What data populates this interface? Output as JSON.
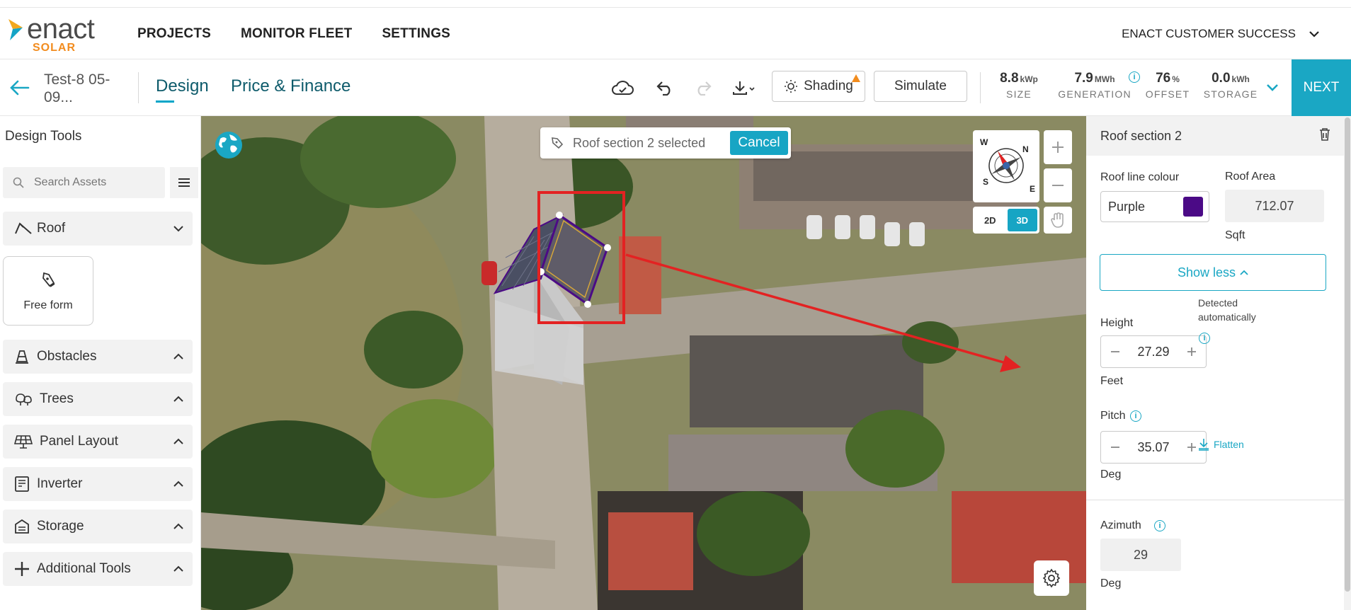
{
  "brand": {
    "name": "enact",
    "sub": "SOLAR"
  },
  "nav": {
    "links": [
      "PROJECTS",
      "MONITOR FLEET",
      "SETTINGS"
    ],
    "account": "ENACT CUSTOMER SUCCESS"
  },
  "header": {
    "project_name": "Test-8 05-09...",
    "tabs": [
      "Design",
      "Price & Finance"
    ],
    "active_tab": "Design",
    "shading_label": "Shading",
    "simulate_label": "Simulate",
    "next_label": "NEXT",
    "stats": [
      {
        "value": "8.8",
        "unit": "kWp",
        "label": "SIZE"
      },
      {
        "value": "7.9",
        "unit": "MWh",
        "label": "GENERATION"
      },
      {
        "value": "76",
        "unit": "%",
        "label": "OFFSET"
      },
      {
        "value": "0.0",
        "unit": "kWh",
        "label": "STORAGE"
      }
    ]
  },
  "sidebar": {
    "title": "Design Tools",
    "search_placeholder": "Search Assets",
    "roof_label": "Roof",
    "freeform_label": "Free form",
    "sections": [
      "Obstacles",
      "Trees",
      "Panel Layout",
      "Inverter",
      "Storage",
      "Additional Tools"
    ]
  },
  "map": {
    "selection_text": "Roof section 2 selected",
    "cancel_label": "Cancel",
    "view_modes": [
      "2D",
      "3D"
    ],
    "active_view": "3D",
    "compass_letters": [
      "N",
      "E",
      "S",
      "W"
    ]
  },
  "panel": {
    "title": "Roof section 2",
    "roof_line_colour_label": "Roof line colour",
    "roof_line_colour_value": "Purple",
    "roof_line_colour_hex": "#4b0a86",
    "roof_area_label": "Roof Area",
    "roof_area_value": "712.07",
    "roof_area_unit": "Sqft",
    "show_less_label": "Show less",
    "height_label": "Height",
    "height_value": "27.29",
    "height_unit": "Feet",
    "detected_text": "Detected automatically",
    "pitch_label": "Pitch",
    "pitch_value": "35.07",
    "pitch_unit": "Deg",
    "flatten_label": "Flatten",
    "azimuth_label": "Azimuth",
    "azimuth_value": "29",
    "azimuth_unit": "Deg"
  },
  "colors": {
    "accent": "#1aa7c4",
    "annotation": "#e32222",
    "brand_orange": "#f28c1e"
  }
}
